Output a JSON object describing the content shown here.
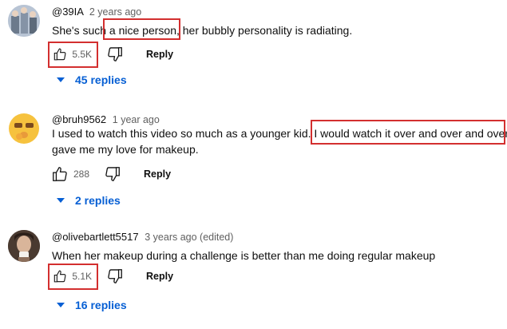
{
  "colors": {
    "highlight": "#d32f2f",
    "link": "#065fd4",
    "muted": "#606060"
  },
  "comments": [
    {
      "author": "@39IA",
      "time": "2 years ago",
      "text": "She's such a nice person, her bubbly personality is radiating.",
      "likes": "5.5K",
      "reply_label": "Reply",
      "replies_label": "45 replies"
    },
    {
      "author": "@bruh9562",
      "time": "1 year ago",
      "text_line1": "I used to watch this video so much as a younger kid. I would watch it over and over and over",
      "text_line2": "gave me my love for makeup.",
      "likes": "288",
      "reply_label": "Reply",
      "replies_label": "2 replies"
    },
    {
      "author": "@olivebartlett5517",
      "time": "3 years ago (edited)",
      "text": "When her makeup during a challenge is better than me doing regular makeup",
      "likes": "5.1K",
      "reply_label": "Reply",
      "replies_label": "16 replies"
    }
  ]
}
